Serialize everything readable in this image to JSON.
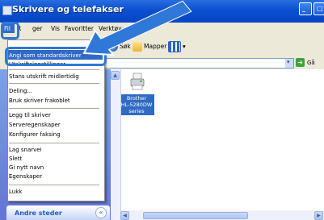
{
  "window": {
    "title": "Skrivere og telefakser"
  },
  "menubar": {
    "items": [
      "Fil",
      "Rediger",
      "Vis",
      "Favoritter",
      "Verktøy"
    ],
    "visible_labels": {
      "file": "Fil",
      "edit_fragment": "R",
      "edit_fragment2": "ger",
      "view": "Vis",
      "favorites": "Favoritter",
      "tools": "Verktøy"
    }
  },
  "toolbar": {
    "search": "Søk",
    "folders": "Mapper"
  },
  "addressbar": {
    "go_label": "Gå"
  },
  "file_menu": {
    "items": [
      {
        "label": "Angi som standardskriver",
        "selected": true
      },
      {
        "label": "Utskriftsinnstillinger",
        "selected": false
      },
      {
        "label": "Stans utskrift midlertidig",
        "selected": false
      },
      {
        "label": "Deling...",
        "selected": false
      },
      {
        "label": "Bruk skriver frakoblet",
        "selected": false
      },
      {
        "label": "Legg til skriver",
        "selected": false
      },
      {
        "label": "Serveregenskaper",
        "selected": false
      },
      {
        "label": "Konfigurer faksing",
        "selected": false
      },
      {
        "label": "Lag snarvei",
        "selected": false
      },
      {
        "label": "Slett",
        "selected": false
      },
      {
        "label": "Gi nytt navn",
        "selected": false
      },
      {
        "label": "Egenskaper",
        "selected": false
      },
      {
        "label": "Lukk",
        "selected": false
      }
    ]
  },
  "task_panel": {
    "other_places": "Andre steder"
  },
  "printers": [
    {
      "name_lines": [
        "Brother",
        "HL-5280DW",
        "series"
      ]
    }
  ],
  "colors": {
    "titlebar": "#0a4fd0",
    "selection": "#316ac5",
    "highlight": "#2f78d8"
  }
}
